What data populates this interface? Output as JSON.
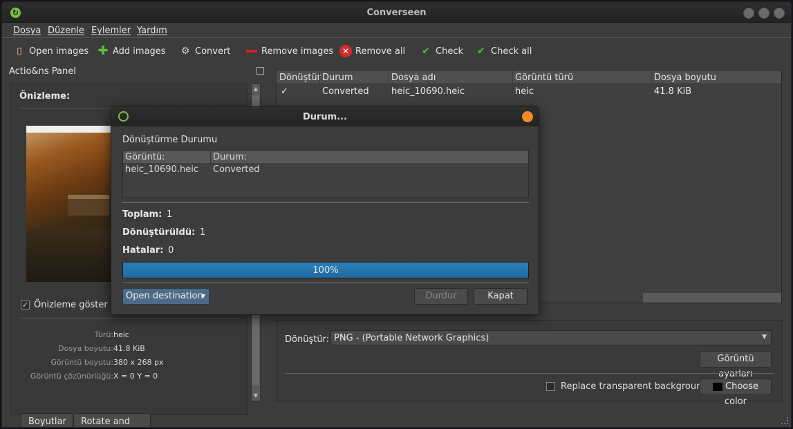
{
  "window": {
    "title": "Converseen"
  },
  "menu": [
    "Dosya",
    "Düzenle",
    "Eylemler",
    "Yardım"
  ],
  "toolbar": {
    "open_images": "Open images",
    "add_images": "Add images",
    "convert": "Convert",
    "remove_images": "Remove images",
    "remove_all": "Remove all",
    "check": "Check",
    "check_all": "Check all"
  },
  "actions_panel": {
    "title": "Actio&ns Panel",
    "preview_heading": "Önizleme:",
    "show_preview_label": "Önizleme göster",
    "show_preview_checked": true,
    "props": [
      {
        "key": "Türü:",
        "value": "heic"
      },
      {
        "key": "Dosya boyutu:",
        "value": "41.8 KiB"
      },
      {
        "key": "Görüntü boyutu:",
        "value": "380 x 268 px"
      },
      {
        "key": "Görüntü çözünürlüğü:",
        "value": "X = 0 Y = 0"
      }
    ],
    "tabs": [
      "Boyutlar",
      "Rotate and flip"
    ]
  },
  "file_table": {
    "columns": [
      "Dönüştür",
      "Durum",
      "Dosya adı",
      "Görüntü türü",
      "Dosya boyutu"
    ],
    "rows": [
      {
        "check": "✓",
        "status": "Converted",
        "filename": "heic_10690.heic",
        "type": "heic",
        "size": "41.8 KiB"
      }
    ]
  },
  "conversion": {
    "label": "Dönüştür:",
    "format": "PNG - (Portable Network Graphics)",
    "image_settings_button": "Görüntü ayarları",
    "replace_transparent_label": "Replace transparent background",
    "replace_transparent_checked": false,
    "choose_color_button": "Choose color"
  },
  "dialog": {
    "title": "Durum...",
    "section": "Dönüştürme Durumu",
    "columns": [
      "Görüntü:",
      "Durum:"
    ],
    "rows": [
      {
        "image": "heic_10690.heic",
        "status": "Converted"
      }
    ],
    "total_label": "Toplam:",
    "total_value": "1",
    "converted_label": "Dönüştürüldü:",
    "converted_value": "1",
    "errors_label": "Hatalar:",
    "errors_value": "0",
    "progress_text": "100%",
    "progress_fraction": 1.0,
    "open_destination": "Open destination",
    "stop_button": "Durdur",
    "close_button": "Kapat"
  },
  "colors": {
    "accent": "#1e6aa0",
    "close_button": "#f08a24",
    "app_green": "#7bc043"
  }
}
